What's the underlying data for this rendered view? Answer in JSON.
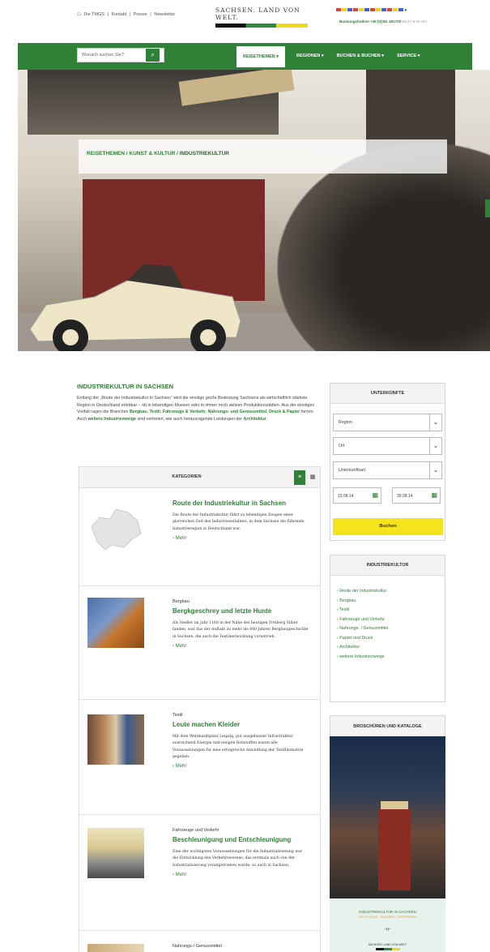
{
  "topbar": {
    "links": [
      "Die TMGS",
      "Kontakt",
      "Presse",
      "Newsletter"
    ],
    "separator": "|",
    "logo_text": "SACHSEN. LAND VON WELT.",
    "hotline_label": "Buchungshotline +49 (0)351 491700",
    "hotline_hours": "Mo-Fr 8-18 Uhr"
  },
  "nav": {
    "search_placeholder": "Wonach suchen Sie?",
    "items": [
      "REISETHEMEN",
      "REGIONEN",
      "BUCHEN & BUCHEN",
      "SERVICE"
    ]
  },
  "hero": {
    "breadcrumb_1": "REISETHEMEN",
    "breadcrumb_2": "KUNST & KULTUR",
    "breadcrumb_sep": " / ",
    "breadcrumb_current": "INDUSTRIEKULTUR"
  },
  "main": {
    "title": "INDUSTRIEKULTUR IN SACHSEN",
    "intro_1": "Entlang der „Route der Industriekultur in Sachsen“ wird die einstige große Bedeutung Sachsens als wirtschaftlich stärkste Region in Deutschland erlebbar – ob in lebendigen Museen oder in immer noch aktiven Produktionsstätten. Aus der einstigen Vielfalt ragen die Branchen ",
    "intro_b1": "Bergbau",
    "intro_c1": ", ",
    "intro_b2": "Textil",
    "intro_c2": ", ",
    "intro_b3": "Fahrzeuge & Verkehr",
    "intro_c3": ", ",
    "intro_b4": "Nahrungs- und Genussmittel",
    "intro_c4": ", ",
    "intro_b5": "Druck & Papier",
    "intro_2": " hervor. Auch ",
    "intro_b6": "weitere Industriezweige",
    "intro_3": " sind vertreten, wie auch herausragende Leistungen der ",
    "intro_b7": "Architektur",
    "intro_4": ".",
    "categories_label": "KATEGORIEN",
    "items": [
      {
        "cat": "",
        "title": "Route der Industriekultur in Sachsen",
        "desc": "Die Route der Industriekultur führt zu lebendigen Zeugen einer glorreichen Zeit des Industriezeitalters, in dem Sachsen die führende Industrieregion in Deutschland war.",
        "more": "› Mehr"
      },
      {
        "cat": "Bergbau",
        "title": "Bergkgeschrey und letzte Hunte",
        "desc": "Als Siedler im Jahr 1168 in der Nähe des heutigen Freiberg Silber fanden, war das der Auftakt zu mehr als 800 Jahren Bergbaugeschichte in Sachsen, die auch die Textilentwicklung vorantrieb.",
        "more": "› Mehr"
      },
      {
        "cat": "Textil",
        "title": "Leute machen Kleider",
        "desc": "Mit dem Weltmarktplatz Leipzig, gut ausgebauter Infrastruktur, ausreichend Energie und einigen Rohstoffen waren alle Voraussetzungen für eine erfolgreiche Ansiedlung der Textilindustrie gegeben.",
        "more": "› Mehr"
      },
      {
        "cat": "Fahrzeuge und Verkehr",
        "title": "Beschleunigung und Entschleunigung",
        "desc": "Eine der wichtigsten Voraussetzungen für die Industrialisierung war die Entwicklung des Verkehrswesens, das erstmals auch von der Industrialisierung vorangetrieben wurde, so auch in Sachsen.",
        "more": "› Mehr"
      },
      {
        "cat": "Nahrungs-/ Genussmittel"
      }
    ]
  },
  "unterkuenfte": {
    "title": "UNTERKÜNFTE",
    "region": "Region",
    "ort": "Ort",
    "art": "Unterkunftsart",
    "date_from": "23.08.14",
    "date_to": "30.08.14",
    "button": "Buchen"
  },
  "industrie": {
    "title": "INDUSTRIEKULTUR",
    "links": [
      "› Route der Industriekultur",
      "› Bergbau",
      "› Textil",
      "› Fahrzeuge und Verkehr",
      "› Nahrungs- / Genussmittel",
      "› Papier und Druck",
      "› Architektur",
      "› weitere Industriezweige"
    ]
  },
  "brochures": {
    "title": "BROSCHÜREN UND KATALOGE",
    "cover_title": "INDUSTRIEKULTUR IN SACHSEN",
    "cover_sub": "ENTDECKEN · ERLEBEN · VERSTEHEN",
    "cover_footer": "SACHSEN. LAND VON WELT."
  },
  "colors": {
    "brand_green": "#2f8137",
    "button_yellow": "#f4e31d"
  },
  "icons": {
    "home": "home-icon",
    "search": "search-icon",
    "calendar": "calendar-icon",
    "list_view": "list-icon",
    "grid_view": "grid-icon"
  }
}
